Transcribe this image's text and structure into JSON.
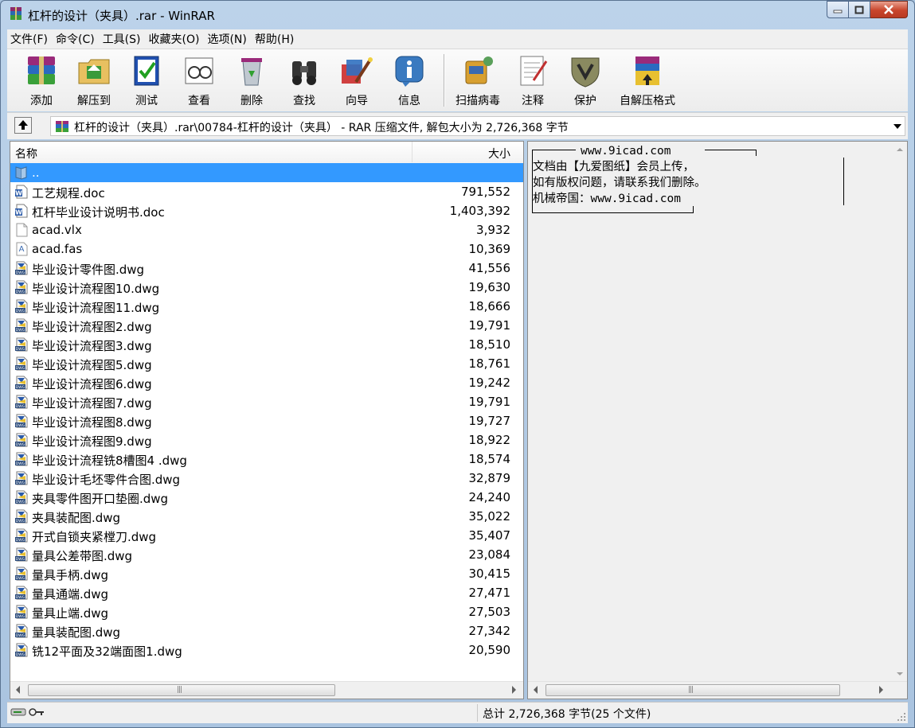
{
  "window": {
    "title": "杠杆的设计（夹具）.rar - WinRAR"
  },
  "menu": [
    {
      "label": "文件(F)"
    },
    {
      "label": "命令(C)"
    },
    {
      "label": "工具(S)"
    },
    {
      "label": "收藏夹(O)"
    },
    {
      "label": "选项(N)"
    },
    {
      "label": "帮助(H)"
    }
  ],
  "toolbar": {
    "add": "添加",
    "extract": "解压到",
    "test": "测试",
    "view": "查看",
    "delete": "删除",
    "find": "查找",
    "wizard": "向导",
    "info": "信息",
    "virus_scan": "扫描病毒",
    "comment": "注释",
    "protect": "保护",
    "sfx": "自解压格式"
  },
  "address": {
    "path": "杠杆的设计（夹具）.rar\\00784-杠杆的设计（夹具） - RAR 压缩文件, 解包大小为 2,726,368 字节"
  },
  "columns": {
    "name": "名称",
    "size": "大小"
  },
  "files": [
    {
      "name": "..",
      "size": "",
      "icon": "folder-up-icon"
    },
    {
      "name": "工艺规程.doc",
      "size": "791,552",
      "icon": "word-doc-icon"
    },
    {
      "name": "杠杆毕业设计说明书.doc",
      "size": "1,403,392",
      "icon": "word-doc-icon"
    },
    {
      "name": "acad.vlx",
      "size": "3,932",
      "icon": "blank-file-icon"
    },
    {
      "name": "acad.fas",
      "size": "10,369",
      "icon": "fas-file-icon"
    },
    {
      "name": "毕业设计零件图.dwg",
      "size": "41,556",
      "icon": "dwg-file-icon"
    },
    {
      "name": "毕业设计流程图10.dwg",
      "size": "19,630",
      "icon": "dwg-file-icon"
    },
    {
      "name": "毕业设计流程图11.dwg",
      "size": "18,666",
      "icon": "dwg-file-icon"
    },
    {
      "name": "毕业设计流程图2.dwg",
      "size": "19,791",
      "icon": "dwg-file-icon"
    },
    {
      "name": "毕业设计流程图3.dwg",
      "size": "18,510",
      "icon": "dwg-file-icon"
    },
    {
      "name": "毕业设计流程图5.dwg",
      "size": "18,761",
      "icon": "dwg-file-icon"
    },
    {
      "name": "毕业设计流程图6.dwg",
      "size": "19,242",
      "icon": "dwg-file-icon"
    },
    {
      "name": "毕业设计流程图7.dwg",
      "size": "19,791",
      "icon": "dwg-file-icon"
    },
    {
      "name": "毕业设计流程图8.dwg",
      "size": "19,727",
      "icon": "dwg-file-icon"
    },
    {
      "name": "毕业设计流程图9.dwg",
      "size": "18,922",
      "icon": "dwg-file-icon"
    },
    {
      "name": "毕业设计流程铣8槽图4 .dwg",
      "size": "18,574",
      "icon": "dwg-file-icon"
    },
    {
      "name": "毕业设计毛坯零件合图.dwg",
      "size": "32,879",
      "icon": "dwg-file-icon"
    },
    {
      "name": "夹具零件图开口垫圈.dwg",
      "size": "24,240",
      "icon": "dwg-file-icon"
    },
    {
      "name": "夹具装配图.dwg",
      "size": "35,022",
      "icon": "dwg-file-icon"
    },
    {
      "name": "开式自锁夹紧樘刀.dwg",
      "size": "35,407",
      "icon": "dwg-file-icon"
    },
    {
      "name": "量具公差带图.dwg",
      "size": "23,084",
      "icon": "dwg-file-icon"
    },
    {
      "name": "量具手柄.dwg",
      "size": "30,415",
      "icon": "dwg-file-icon"
    },
    {
      "name": "量具通端.dwg",
      "size": "27,471",
      "icon": "dwg-file-icon"
    },
    {
      "name": "量具止端.dwg",
      "size": "27,503",
      "icon": "dwg-file-icon"
    },
    {
      "name": "量具装配图.dwg",
      "size": "27,342",
      "icon": "dwg-file-icon"
    },
    {
      "name": "铣12平面及32端面图1.dwg",
      "size": "20,590",
      "icon": "dwg-file-icon"
    }
  ],
  "comment": {
    "header": "www.9icad.com",
    "lines": [
      "文档由【九爱图纸】会员上传，",
      "如有版权问题，请联系我们删除。",
      "机械帝国：www.9icad.com"
    ]
  },
  "status": {
    "total": "总计 2,726,368 字节(25 个文件)"
  },
  "colors": {
    "selection": "#3399ff",
    "close_button": "#c8452c"
  }
}
